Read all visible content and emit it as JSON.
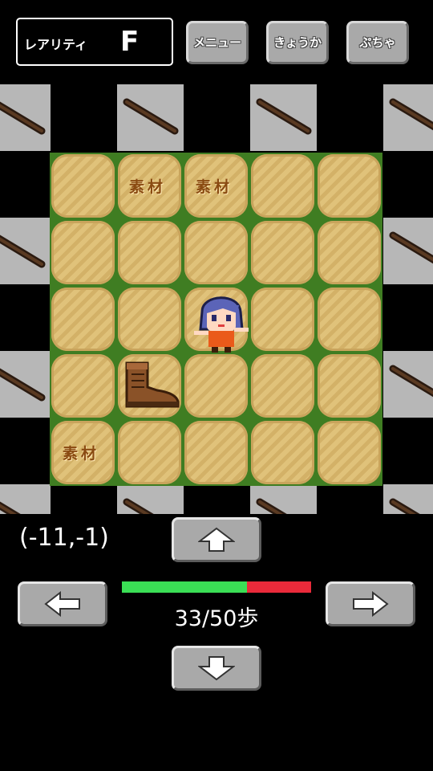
{
  "header": {
    "rarity_label": "レアリティ",
    "rarity_value": "F",
    "menu_label": "メニュー",
    "enhance_label": "きょうか",
    "gacha_label": "ぷちゃ"
  },
  "map": {
    "material_label": "素材",
    "materials": [
      {
        "col": 1,
        "row": 0
      },
      {
        "col": 2,
        "row": 0
      },
      {
        "col": 0,
        "row": 4
      }
    ],
    "item_icon": "boots-icon",
    "player_icon": "girl-character-icon"
  },
  "status": {
    "coords": "(-11,-1)",
    "steps_text": "33/50歩",
    "steps_current": 33,
    "steps_max": 50
  },
  "controls": {
    "up": "arrow-up-icon",
    "down": "arrow-down-icon",
    "left": "arrow-left-icon",
    "right": "arrow-right-icon"
  },
  "colors": {
    "bar_fill": "#3adf55",
    "bar_empty": "#ea2a3a",
    "grass_border": "#3f7d22"
  }
}
